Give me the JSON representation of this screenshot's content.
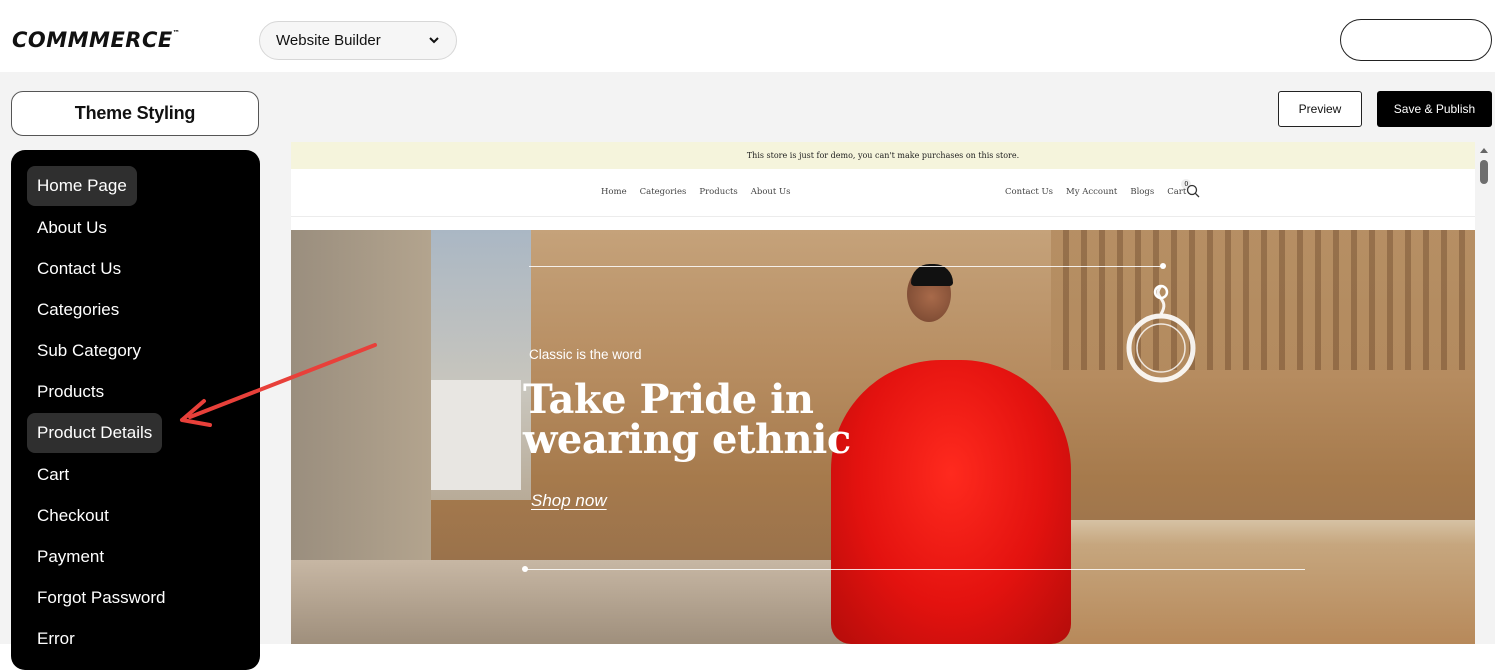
{
  "header": {
    "logo_text": "COMMMERCE",
    "logo_tm": "™",
    "builder_select_value": "Website Builder"
  },
  "left_panel": {
    "theme_button_label": "Theme Styling",
    "nav_items": [
      {
        "label": "Home Page",
        "active": true
      },
      {
        "label": "About Us",
        "active": false
      },
      {
        "label": "Contact Us",
        "active": false
      },
      {
        "label": "Categories",
        "active": false
      },
      {
        "label": "Sub Category",
        "active": false
      },
      {
        "label": "Products",
        "active": false
      },
      {
        "label": "Product Details",
        "active": true
      },
      {
        "label": "Cart",
        "active": false
      },
      {
        "label": "Checkout",
        "active": false
      },
      {
        "label": "Payment",
        "active": false
      },
      {
        "label": "Forgot Password",
        "active": false
      },
      {
        "label": "Error",
        "active": false
      }
    ]
  },
  "toolbar": {
    "preview_label": "Preview",
    "publish_label": "Save & Publish"
  },
  "store_preview": {
    "demo_notice": "This store is just for demo, you can't make purchases on this store.",
    "nav_left": [
      "Home",
      "Categories",
      "Products",
      "About Us"
    ],
    "nav_right": [
      "Contact Us",
      "My Account",
      "Blogs",
      "Cart"
    ],
    "cart_count": "0",
    "hero": {
      "eyebrow": "Classic is the word",
      "headline_line1": "Take Pride in",
      "headline_line2": "wearing ethnic",
      "cta": "Shop now"
    }
  },
  "colors": {
    "nav_panel_bg": "#000000",
    "nav_active_bg": "#2f2f2f",
    "demo_bar_bg": "#f5f4dc",
    "publish_bg": "#000000",
    "annotation_arrow": "#e8403a"
  }
}
